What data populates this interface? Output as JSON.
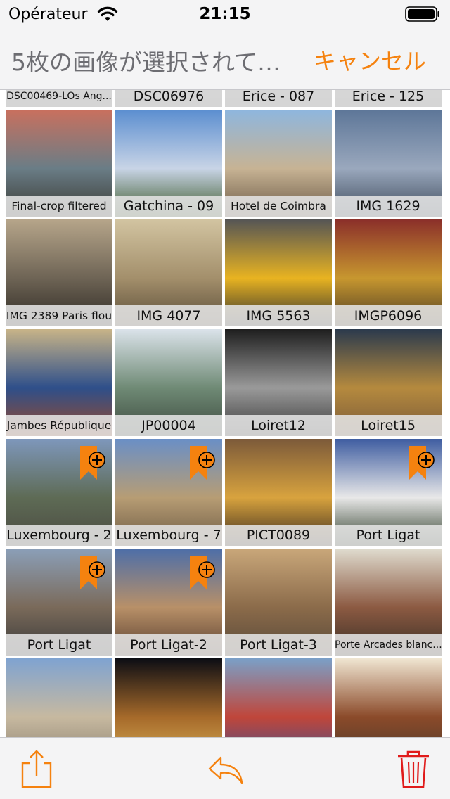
{
  "status": {
    "carrier": "Opérateur",
    "time": "21:15"
  },
  "nav": {
    "title": "5枚の画像が選択されて…",
    "cancel": "キャンセル"
  },
  "colors": {
    "accent": "#f5820f",
    "delete": "#e01b1b"
  },
  "grid": {
    "top_row": [
      {
        "caption": "DSC00469-LOs Ang...",
        "size": "small"
      },
      {
        "caption": "DSC06976",
        "size": "normal"
      },
      {
        "caption": "Erice - 087",
        "size": "normal"
      },
      {
        "caption": "Erice - 125",
        "size": "normal"
      }
    ],
    "items": [
      {
        "caption": "Final-crop filtered",
        "size": "mid",
        "bookmark": false,
        "colors": [
          "#c9705e",
          "#6a7d86",
          "#3a3a35"
        ]
      },
      {
        "caption": "Gatchina - 09",
        "size": "normal",
        "bookmark": false,
        "colors": [
          "#5b8ed0",
          "#c8d4e6",
          "#3d5a2b"
        ]
      },
      {
        "caption": "Hotel de Coimbra",
        "size": "mid",
        "bookmark": false,
        "colors": [
          "#8eb6de",
          "#c7b394",
          "#6c5a46"
        ]
      },
      {
        "caption": "IMG 1629",
        "size": "normal",
        "bookmark": false,
        "colors": [
          "#5d7698",
          "#9aa8bd",
          "#3e4b5c"
        ]
      },
      {
        "caption": "IMG 2389 Paris flou",
        "size": "mid",
        "bookmark": false,
        "colors": [
          "#b6a58a",
          "#6e6455",
          "#2e2a24"
        ]
      },
      {
        "caption": "IMG 4077",
        "size": "normal",
        "bookmark": false,
        "colors": [
          "#d2c4a1",
          "#a38f6b",
          "#5a4c38"
        ]
      },
      {
        "caption": "IMG 5563",
        "size": "normal",
        "bookmark": false,
        "colors": [
          "#555555",
          "#e8b321",
          "#2f2f2f"
        ]
      },
      {
        "caption": "IMGP6096",
        "size": "normal",
        "bookmark": false,
        "colors": [
          "#8b2f2a",
          "#c7972f",
          "#4c3b24"
        ]
      },
      {
        "caption": "Jambes République",
        "size": "mid",
        "bookmark": false,
        "colors": [
          "#c8b488",
          "#2e4f8a",
          "#9a4a2a"
        ]
      },
      {
        "caption": "JP00004",
        "size": "normal",
        "bookmark": false,
        "colors": [
          "#dbe3ea",
          "#6f8a75",
          "#3d4a3f"
        ]
      },
      {
        "caption": "Loiret12",
        "size": "normal",
        "bookmark": false,
        "colors": [
          "#1e1e1e",
          "#9a9a9a",
          "#3a3a3a"
        ]
      },
      {
        "caption": "Loiret15",
        "size": "normal",
        "bookmark": false,
        "colors": [
          "#2b3a4d",
          "#b58a3e",
          "#7a5a3a"
        ]
      },
      {
        "caption": "Luxembourg - 2",
        "size": "normal",
        "bookmark": true,
        "colors": [
          "#7e97bb",
          "#5e6b55",
          "#4b4a42"
        ]
      },
      {
        "caption": "Luxembourg - 7",
        "size": "normal",
        "bookmark": true,
        "colors": [
          "#6a8fc6",
          "#b79d74",
          "#6d5a44"
        ]
      },
      {
        "caption": "PICT0089",
        "size": "normal",
        "bookmark": false,
        "colors": [
          "#7c5a3a",
          "#d8a33e",
          "#3b2b1e"
        ]
      },
      {
        "caption": "Port Ligat",
        "size": "normal",
        "bookmark": true,
        "colors": [
          "#3f5da1",
          "#e8e8e8",
          "#2f3d2a"
        ]
      },
      {
        "caption": "Port Ligat",
        "size": "normal",
        "bookmark": true,
        "colors": [
          "#8b9fb8",
          "#7a6a5a",
          "#3a3a3a"
        ]
      },
      {
        "caption": "Port Ligat-2",
        "size": "normal",
        "bookmark": true,
        "colors": [
          "#4d6ea8",
          "#b89068",
          "#5a4030"
        ]
      },
      {
        "caption": "Port Ligat-3",
        "size": "normal",
        "bookmark": false,
        "colors": [
          "#c9a77a",
          "#8b6b4a",
          "#5a4a3a"
        ]
      },
      {
        "caption": "Porte Arcades blanc...",
        "size": "small",
        "bookmark": false,
        "colors": [
          "#e0dccf",
          "#8c5a42",
          "#3b3026"
        ]
      },
      {
        "caption": "",
        "size": "normal",
        "bookmark": false,
        "colors": [
          "#7fa3d1",
          "#c7b9a0",
          "#8b8070"
        ]
      },
      {
        "caption": "",
        "size": "normal",
        "bookmark": false,
        "colors": [
          "#0c0d14",
          "#a66a2a",
          "#d8b058"
        ]
      },
      {
        "caption": "",
        "size": "normal",
        "bookmark": false,
        "colors": [
          "#7aa0c8",
          "#c0463a",
          "#3d4f8f"
        ]
      },
      {
        "caption": "",
        "size": "normal",
        "bookmark": false,
        "colors": [
          "#f0e6d2",
          "#8b4a2a",
          "#4a3b2a"
        ]
      }
    ]
  },
  "toolbar": {
    "icons": [
      "share-icon",
      "reply-icon",
      "trash-icon"
    ]
  }
}
